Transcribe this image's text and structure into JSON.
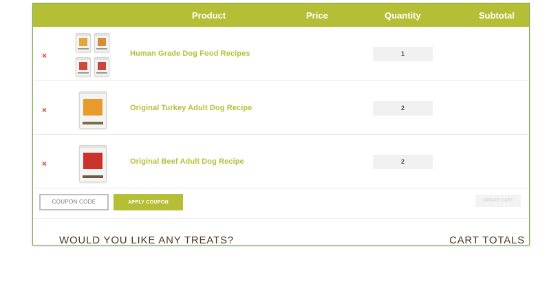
{
  "cart": {
    "headers": {
      "product": "Product",
      "price": "Price",
      "quantity": "Quantity",
      "subtotal": "Subtotal"
    },
    "items": [
      {
        "remove": "×",
        "name": "Human Grade Dog Food Recipes",
        "quantity": "1",
        "price": "",
        "subtotal": ""
      },
      {
        "remove": "×",
        "name": "Original Turkey Adult Dog Recipe",
        "quantity": "2",
        "price": "",
        "subtotal": ""
      },
      {
        "remove": "×",
        "name": "Original Beef Adult Dog Recipe",
        "quantity": "2",
        "price": "",
        "subtotal": ""
      }
    ],
    "actions": {
      "coupon_placeholder": "COUPON CODE",
      "apply_coupon": "APPLY COUPON",
      "update_cart": "UPDATE CART"
    }
  },
  "sections": {
    "treats_title": "WOULD YOU LIKE ANY TREATS?",
    "totals_title": "CART TOTALS"
  },
  "colors": {
    "accent": "#b5bf36",
    "remove": "#d63b2e",
    "heading": "#4a3521"
  },
  "icons": {
    "remove": "close-icon",
    "product_image": "dog-food-bag-image"
  }
}
